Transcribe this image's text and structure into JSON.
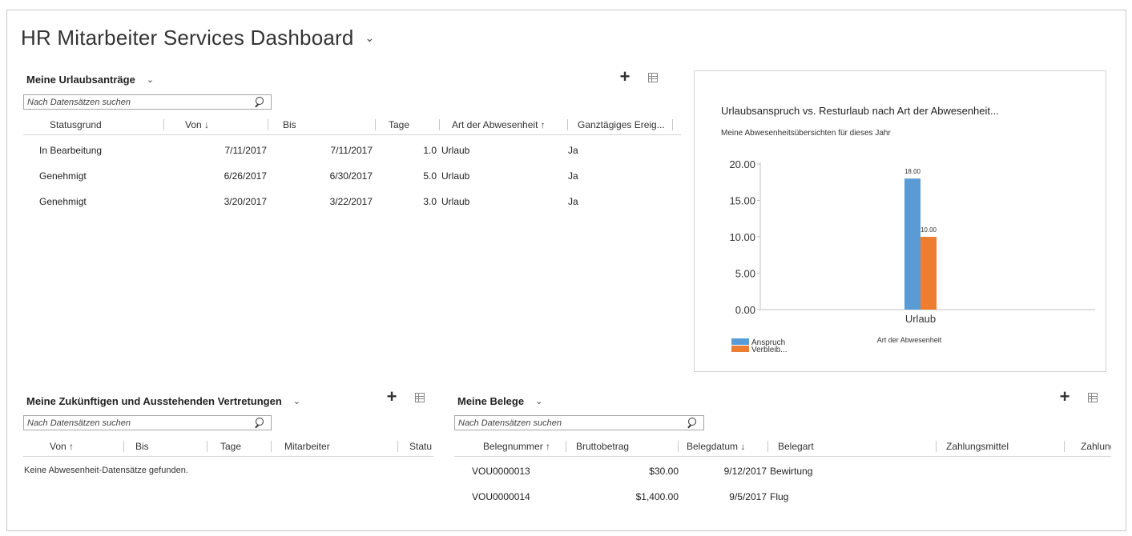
{
  "dashboard": {
    "title": "HR Mitarbeiter Services Dashboard"
  },
  "leave": {
    "title": "Meine Urlaubsanträge",
    "search_placeholder": "Nach Datensätzen suchen",
    "columns": [
      "Statusgrund",
      "Von ↓",
      "Bis",
      "Tage",
      "Art der Abwesenheit ↑",
      "Ganztägiges Ereig..."
    ],
    "rows": [
      [
        "In Bearbeitung",
        "7/11/2017",
        "7/11/2017",
        "1.0",
        "Urlaub",
        "Ja"
      ],
      [
        "Genehmigt",
        "6/26/2017",
        "6/30/2017",
        "5.0",
        "Urlaub",
        "Ja"
      ],
      [
        "Genehmigt",
        "3/20/2017",
        "3/22/2017",
        "3.0",
        "Urlaub",
        "Ja"
      ]
    ]
  },
  "deputies": {
    "title": "Meine Zukünftigen und Ausstehenden Vertretungen",
    "search_placeholder": "Nach Datensätzen suchen",
    "columns": [
      "Von ↑",
      "Bis",
      "Tage",
      "Mitarbeiter",
      "Statu"
    ],
    "empty_message": "Keine Abwesenheit-Datensätze gefunden."
  },
  "receipts": {
    "title": "Meine Belege",
    "search_placeholder": "Nach Datensätzen suchen",
    "columns": [
      "Belegnummer ↑",
      "Bruttobetrag",
      "Belegdatum ↓",
      "Belegart",
      "Zahlungsmittel",
      "Zahlung"
    ],
    "rows": [
      [
        "VOU0000013",
        "$30.00",
        "9/12/2017",
        "Bewirtung"
      ],
      [
        "VOU0000014",
        "$1,400.00",
        "9/5/2017",
        "Flug"
      ]
    ]
  },
  "icons": {
    "dropdown": "chevron-down-icon",
    "add": "plus-icon",
    "view": "grid-view-icon",
    "search": "search-icon"
  },
  "chart_data": {
    "type": "bar",
    "title": "Urlaubsanspruch vs. Resturlaub nach Art der Abwesenheit...",
    "subtitle": "Meine Abwesenheitsübersichten für dieses Jahr",
    "xlabel": "Art der Abwesenheit",
    "ylabel": "",
    "categories": [
      "Urlaub"
    ],
    "series": [
      {
        "name": "Anspruch",
        "values": [
          18.0
        ],
        "labels": [
          "18.00"
        ],
        "color": "#5b9bd5"
      },
      {
        "name": "Verbleib...",
        "values": [
          10.0
        ],
        "labels": [
          "10.00"
        ],
        "color": "#ed7d31"
      }
    ],
    "ylim": [
      0,
      20
    ],
    "yticks": [
      "0.00",
      "5.00",
      "10.00",
      "15.00",
      "20.00"
    ],
    "legend": "bottom-left",
    "grid": false
  }
}
